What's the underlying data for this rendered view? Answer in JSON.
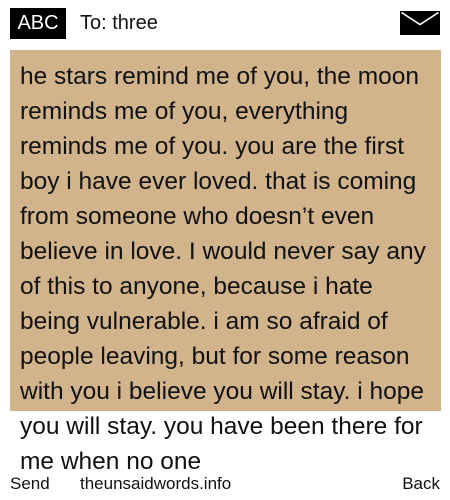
{
  "header": {
    "input_mode": "ABC",
    "recipient": "To: three",
    "envelope_icon": "envelope-icon"
  },
  "message": {
    "text": "he stars remind me of you, the moon reminds me of you, everything reminds me of you. you are the first boy i have ever loved. that is coming from someone who doesn’t even believe in love. I would never say any of this to anyone, because i hate being vulnerable. i am so afraid of people leaving, but for some reason with you i believe you will stay. i hope you will stay. you have been there for me when no one",
    "panel_color": "#d2b48c"
  },
  "softkeys": {
    "left": "Send",
    "center": "theunsaidwords.info",
    "right": "Back"
  }
}
